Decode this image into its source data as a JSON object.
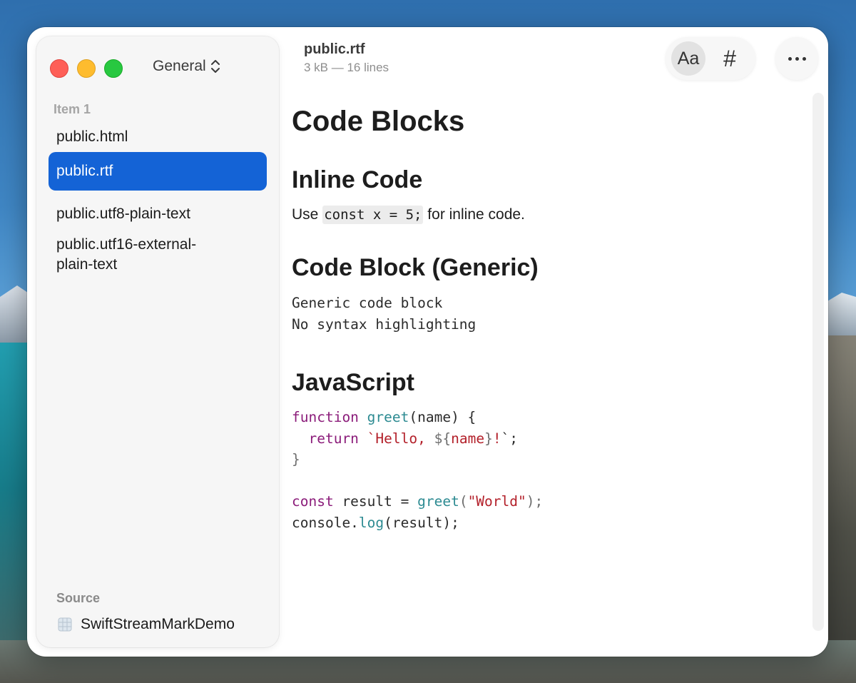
{
  "sidebar": {
    "view_selector": "General",
    "section_label": "Item 1",
    "items": [
      {
        "label": "public.html"
      },
      {
        "label": "public.rtf",
        "selected": true
      },
      {
        "label": "public.utf8-plain-text"
      },
      {
        "label": "public.utf16-external-",
        "label2": "plain-text"
      }
    ],
    "source_label": "Source",
    "source_item": "SwiftStreamMarkDemo"
  },
  "header": {
    "title": "public.rtf",
    "meta": "3 kB — 16 lines",
    "aa_label": "Aa",
    "hash_label": "#"
  },
  "document": {
    "h1": "Code Blocks",
    "h2_inline": "Inline Code",
    "para_pre": "Use ",
    "para_code": "const x = 5;",
    "para_post": " for inline code.",
    "h2_generic": "Code Block (Generic)",
    "generic_lines": [
      "Generic code block",
      "No syntax highlighting"
    ],
    "h2_js": "JavaScript",
    "js": {
      "l1_kw": "function",
      "l1_fn": "greet",
      "l1_rest": "(name) {",
      "l2_kw": "return",
      "l2_str1": "`Hello, ",
      "l2_interp_open": "${",
      "l2_name": "name",
      "l2_interp_close": "}",
      "l2_str2": "!",
      "l2_tail": "`;",
      "l3": "}",
      "l5_kw": "const",
      "l5_var": " result = ",
      "l5_fn": "greet",
      "l5_str": "\"World\"",
      "l6_obj": "console.",
      "l6_fn": "log",
      "l6_rest": "(result);"
    }
  },
  "colors": {
    "accent": "#1463d6",
    "keyword": "#8b1c7a",
    "function": "#2d8b92",
    "string": "#b3202a"
  }
}
